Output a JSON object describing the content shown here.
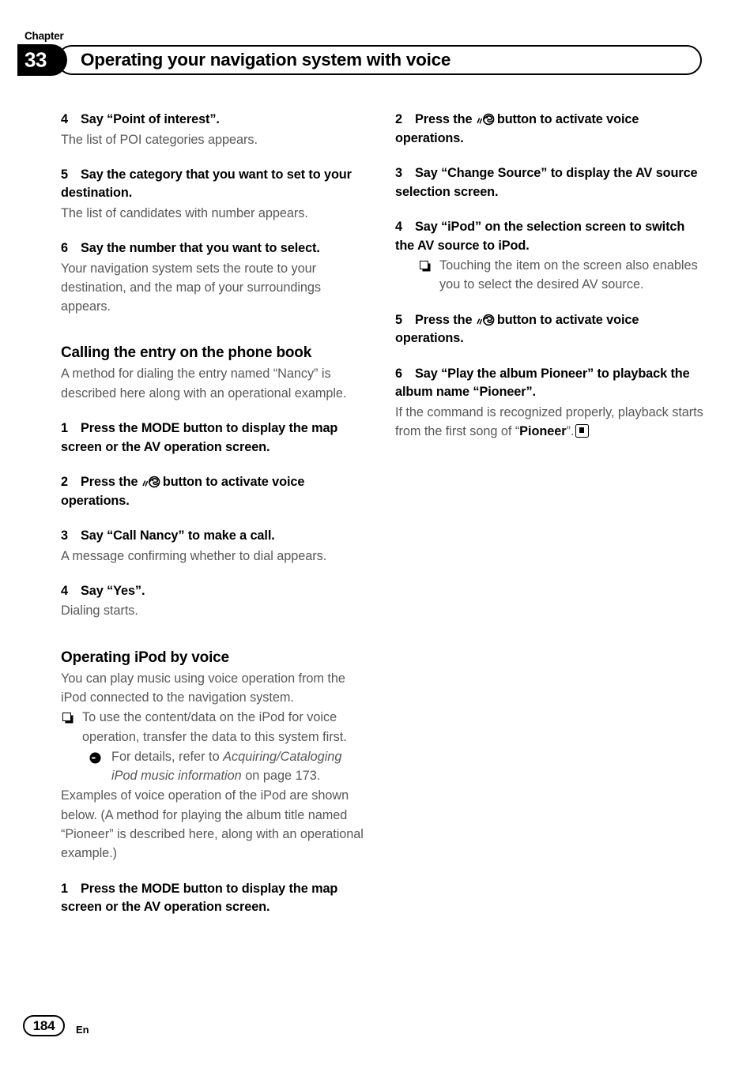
{
  "header": {
    "chapter_label": "Chapter",
    "chapter_number": "33",
    "title": "Operating your navigation system with voice"
  },
  "footer": {
    "page_number": "184",
    "language": "En"
  },
  "icons": {
    "voice_button": "voice-command-icon",
    "note_bullet": "note-square-icon",
    "reference_bullet": "arrow-circle-icon",
    "end_of_section": "end-of-section-icon"
  },
  "left_column": {
    "blocks": [
      {
        "type": "step",
        "number": "4",
        "text": "Say “Point of interest”."
      },
      {
        "type": "body",
        "text": "The list of POI categories appears."
      },
      {
        "type": "step",
        "number": "5",
        "text": "Say the category that you want to set to your destination."
      },
      {
        "type": "body",
        "text": "The list of candidates with number appears."
      },
      {
        "type": "step",
        "number": "6",
        "text": "Say the number that you want to select."
      },
      {
        "type": "body",
        "text": "Your navigation system sets the route to your destination, and the map of your surroundings appears."
      },
      {
        "type": "heading",
        "text": "Calling the entry on the phone book"
      },
      {
        "type": "body",
        "text": "A method for dialing the entry named “Nancy” is described here along with an operational example."
      },
      {
        "type": "step",
        "number": "1",
        "text": "Press the MODE button to display the map screen or the AV operation screen."
      },
      {
        "type": "step_icon",
        "number": "2",
        "text_before": "Press the",
        "text_after": "button to activate voice operations."
      },
      {
        "type": "step",
        "number": "3",
        "text": "Say “Call Nancy” to make a call."
      },
      {
        "type": "body",
        "text": "A message confirming whether to dial appears."
      },
      {
        "type": "step",
        "number": "4",
        "text": "Say “Yes”."
      },
      {
        "type": "body",
        "text": "Dialing starts."
      },
      {
        "type": "heading",
        "text": "Operating iPod by voice"
      },
      {
        "type": "body",
        "text": "You can play music using voice operation from the iPod connected to the navigation system."
      },
      {
        "type": "note",
        "text": "To use the content/data on the iPod for voice operation, transfer the data to this system first."
      },
      {
        "type": "reference",
        "prefix": "For details, refer to ",
        "italic": "Acquiring/Cataloging iPod music information",
        "suffix": " on page 173."
      },
      {
        "type": "body",
        "text": "Examples of voice operation of the iPod are shown below. (A method for playing the album title named “Pioneer” is described here, along with an operational example.)"
      },
      {
        "type": "step",
        "number": "1",
        "text": "Press the MODE button to display the map screen or the AV operation screen."
      }
    ]
  },
  "right_column": {
    "blocks": [
      {
        "type": "step_icon",
        "number": "2",
        "text_before": "Press the",
        "text_after": "button to activate voice operations."
      },
      {
        "type": "step",
        "number": "3",
        "text": "Say “Change Source” to display the AV source selection screen."
      },
      {
        "type": "step",
        "number": "4",
        "text": "Say “iPod” on the selection screen to switch the AV source to iPod."
      },
      {
        "type": "note",
        "text": "Touching the item on the screen also enables you to select the desired AV source."
      },
      {
        "type": "step_icon",
        "number": "5",
        "text_before": "Press the",
        "text_after": "button to activate voice operations."
      },
      {
        "type": "step",
        "number": "6",
        "text": "Say “Play the album Pioneer” to playback the album name “Pioneer”."
      },
      {
        "type": "body_end",
        "prefix": "If the command is recognized properly, playback starts from the first song of “",
        "bold": "Pioneer",
        "suffix": "”."
      }
    ]
  }
}
